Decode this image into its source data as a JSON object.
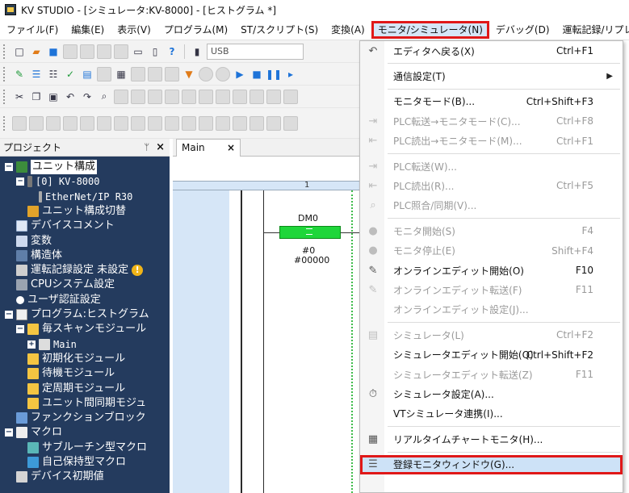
{
  "window": {
    "title": "KV STUDIO - [シミュレータ:KV-8000] - [ヒストグラム *]"
  },
  "menubar": {
    "items": [
      {
        "label": "ファイル(F)"
      },
      {
        "label": "編集(E)"
      },
      {
        "label": "表示(V)"
      },
      {
        "label": "プログラム(M)"
      },
      {
        "label": "ST/スクリプト(S)"
      },
      {
        "label": "変換(A)"
      },
      {
        "label": "モニタ/シミュレータ(N)",
        "active": true
      },
      {
        "label": "デバッグ(D)"
      },
      {
        "label": "運転記録/リプレイ(R"
      }
    ]
  },
  "toolbar": {
    "connection_value": "USB"
  },
  "project": {
    "title": "プロジェクト",
    "pin_icon": "pin-icon",
    "close_label": "×",
    "tree": [
      {
        "label": "ユニット構成",
        "icon": "ic-unit",
        "expander": "−",
        "level": 0,
        "selected": true
      },
      {
        "label": "[0]  KV-8000",
        "icon": "ic-plc",
        "expander": "−",
        "level": 1,
        "mono": true
      },
      {
        "label": "EtherNet/IP   R30",
        "icon": "ic-net",
        "level": 2,
        "mono": true
      },
      {
        "label": "ユニット構成切替",
        "icon": "ic-sw",
        "level": 1
      },
      {
        "label": "デバイスコメント",
        "icon": "ic-doc",
        "level": 0
      },
      {
        "label": "変数",
        "icon": "ic-var",
        "level": 0
      },
      {
        "label": "構造体",
        "icon": "ic-struct",
        "level": 0
      },
      {
        "label": "運転記録設定 未設定",
        "icon": "ic-log",
        "level": 0,
        "warning": "!"
      },
      {
        "label": "CPUシステム設定",
        "icon": "ic-cpu",
        "level": 0
      },
      {
        "label": "ユーザ認証設定",
        "icon": "ic-user",
        "level": 0
      },
      {
        "label": "プログラム:ヒストグラム",
        "icon": "ic-prog",
        "expander": "−",
        "level": 0
      },
      {
        "label": "毎スキャンモジュール",
        "icon": "ic-folder",
        "expander": "−",
        "level": 1
      },
      {
        "label": "Main",
        "icon": "ic-main",
        "expander": "+",
        "level": 2,
        "mono": true
      },
      {
        "label": "初期化モジュール",
        "icon": "ic-folder",
        "level": 1
      },
      {
        "label": "待機モジュール",
        "icon": "ic-folder",
        "level": 1
      },
      {
        "label": "定周期モジュール",
        "icon": "ic-folder",
        "level": 1
      },
      {
        "label": "ユニット間同期モジュ",
        "icon": "ic-folder",
        "level": 1
      },
      {
        "label": "ファンクションブロック",
        "icon": "ic-func",
        "level": 0
      },
      {
        "label": "マクロ",
        "icon": "ic-macro",
        "expander": "−",
        "level": 0
      },
      {
        "label": "サブルーチン型マクロ",
        "icon": "ic-sub",
        "level": 1
      },
      {
        "label": "自己保持型マクロ",
        "icon": "ic-self",
        "level": 1
      },
      {
        "label": "デバイス初期値",
        "icon": "ic-init",
        "level": 0
      }
    ]
  },
  "editor": {
    "tab_label": "Main",
    "tab_close": "×",
    "column_number": "1",
    "contact_device": "DM0",
    "contact_symbol": "=",
    "operand1": "#0",
    "operand2": "#00000"
  },
  "dropdown": {
    "items": [
      {
        "label": "エディタへ戻る(X)",
        "shortcut": "Ctrl+F1",
        "enabled": true,
        "icon": "back-to-editor-icon",
        "glyph": "↶"
      },
      {
        "sep": true
      },
      {
        "label": "通信設定(T)",
        "shortcut": "",
        "enabled": true,
        "submenu": true
      },
      {
        "sep": true
      },
      {
        "label": "モニタモード(B)...",
        "shortcut": "Ctrl+Shift+F3",
        "enabled": true
      },
      {
        "label": "PLC転送→モニタモード(C)...",
        "shortcut": "Ctrl+F8",
        "enabled": false,
        "icon": "plc-transfer-monitor-icon",
        "glyph": "⇥"
      },
      {
        "label": "PLC読出→モニタモード(M)...",
        "shortcut": "Ctrl+F1",
        "enabled": false,
        "icon": "plc-read-monitor-icon",
        "glyph": "⇤"
      },
      {
        "sep": true
      },
      {
        "label": "PLC転送(W)...",
        "shortcut": "",
        "enabled": false,
        "icon": "plc-transfer-icon",
        "glyph": "⇥"
      },
      {
        "label": "PLC読出(R)...",
        "shortcut": "Ctrl+F5",
        "enabled": false,
        "icon": "plc-read-icon",
        "glyph": "⇤"
      },
      {
        "label": "PLC照合/同期(V)...",
        "shortcut": "",
        "enabled": false,
        "icon": "plc-verify-icon",
        "glyph": "⌕"
      },
      {
        "sep": true
      },
      {
        "label": "モニタ開始(S)",
        "shortcut": "F4",
        "enabled": false,
        "icon": "monitor-start-icon",
        "glyph": "●"
      },
      {
        "label": "モニタ停止(E)",
        "shortcut": "Shift+F4",
        "enabled": false,
        "icon": "monitor-stop-icon",
        "glyph": "●"
      },
      {
        "label": "オンラインエディット開始(O)",
        "shortcut": "F10",
        "enabled": true,
        "icon": "online-edit-icon",
        "glyph": "✎"
      },
      {
        "label": "オンラインエディット転送(F)",
        "shortcut": "F11",
        "enabled": false,
        "icon": "online-edit-transfer-icon",
        "glyph": "✎"
      },
      {
        "label": "オンラインエディット設定(J)...",
        "shortcut": "",
        "enabled": false
      },
      {
        "sep": true
      },
      {
        "label": "シミュレータ(L)",
        "shortcut": "Ctrl+F2",
        "enabled": false,
        "icon": "simulator-icon",
        "glyph": "▤"
      },
      {
        "label": "シミュレータエディット開始(Q)",
        "shortcut": "Ctrl+Shift+F2",
        "enabled": true
      },
      {
        "label": "シミュレータエディット転送(Z)",
        "shortcut": "F11",
        "enabled": false
      },
      {
        "label": "シミュレータ設定(A)...",
        "shortcut": "",
        "enabled": true,
        "icon": "timer-icon",
        "glyph": "⏱"
      },
      {
        "label": "VTシミュレータ連携(I)...",
        "shortcut": "",
        "enabled": true
      },
      {
        "sep": true
      },
      {
        "label": "リアルタイムチャートモニタ(H)...",
        "shortcut": "",
        "enabled": true,
        "icon": "realtime-chart-icon",
        "glyph": "▦"
      },
      {
        "sep": true
      },
      {
        "label": "登録モニタウィンドウ(G)...",
        "shortcut": "",
        "enabled": true,
        "icon": "register-monitor-icon",
        "glyph": "☰",
        "hover": true,
        "boxed": true
      }
    ]
  }
}
